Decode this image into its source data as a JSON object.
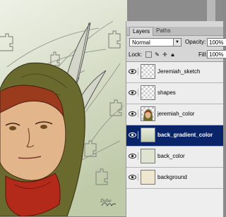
{
  "layers_panel": {
    "tabs": [
      {
        "label": "Layers"
      },
      {
        "label": "Paths"
      }
    ],
    "blend_mode": "Normal",
    "opacity_label": "Opacity:",
    "opacity_value": "100%",
    "lock_label": "Lock:",
    "fill_label": "Fill:",
    "fill_value": "100%",
    "layers": [
      {
        "name": "Jeremiah_sketch",
        "visible": true,
        "selected": false
      },
      {
        "name": "shapes",
        "visible": true,
        "selected": false
      },
      {
        "name": "jeremiah_color",
        "visible": true,
        "selected": false
      },
      {
        "name": "back_gradient_color",
        "visible": true,
        "selected": true
      },
      {
        "name": "back_color",
        "visible": true,
        "selected": false
      },
      {
        "name": "background",
        "visible": true,
        "selected": false
      }
    ]
  },
  "canvas": {
    "signature": "Dobe"
  },
  "colors": {
    "selection": "#0a246a",
    "panel": "#d6d6d6",
    "hood": "#6b6a2e",
    "scarf": "#b32a1a",
    "skin": "#e3b58a",
    "hair": "#9a3b1e"
  }
}
